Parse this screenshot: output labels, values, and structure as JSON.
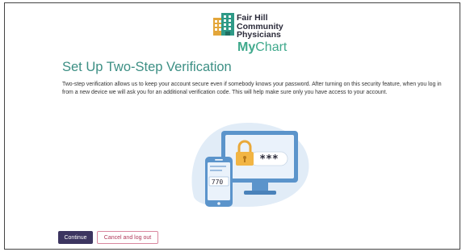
{
  "logo": {
    "org_lines": [
      "Fair Hill",
      "Community",
      "Physicians"
    ],
    "brand_my": "My",
    "brand_chart": "Chart"
  },
  "page": {
    "title": "Set Up Two-Step Verification",
    "description": "Two-step verification allows us to keep your account secure even if somebody knows your password. After turning on this security feature, when you log in from a new device we will ask you for an additional verification code. This will help make sure only you have access to your account."
  },
  "illustration": {
    "password_mask": "***",
    "phone_code": "770"
  },
  "actions": {
    "continue_label": "Continue",
    "cancel_label": "Cancel and log out"
  },
  "colors": {
    "brand_teal": "#3fa98c",
    "title_teal": "#3c8f84",
    "primary_button": "#3c3560",
    "cancel_text": "#b03a5b"
  }
}
